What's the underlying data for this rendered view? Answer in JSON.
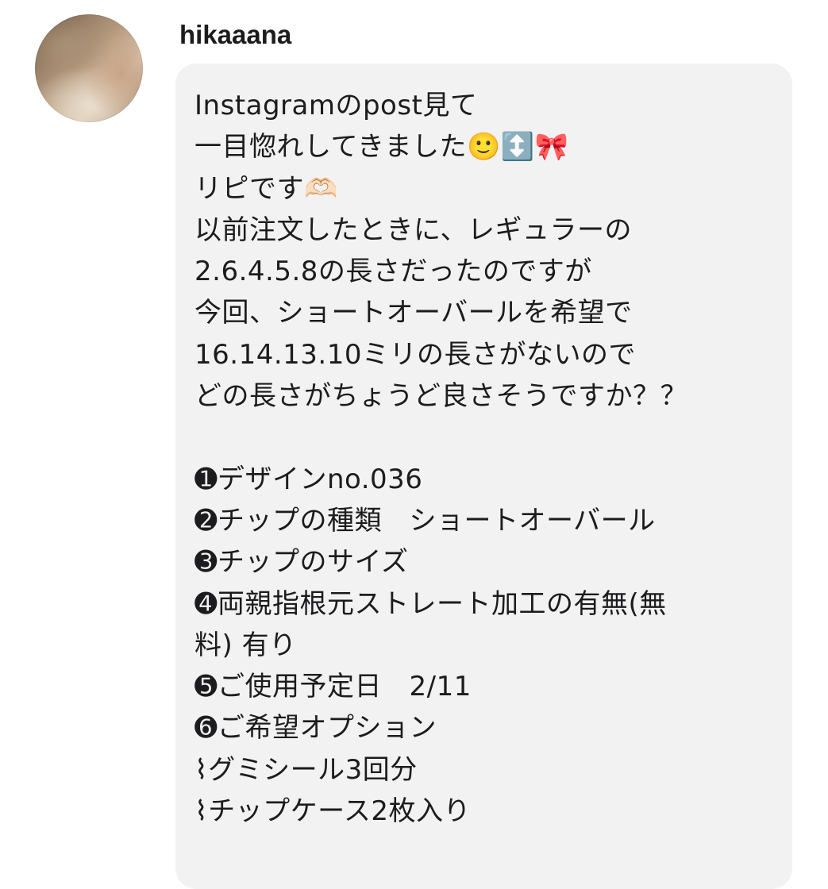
{
  "post": {
    "author": {
      "username": "hikaaana",
      "avatar_icon": "profile-photo"
    },
    "message": {
      "lines": [
        "Instagramのpost見て",
        "一目惚れしてきました🙂↕️🎀",
        "リピです🫶🏻",
        "以前注文したときに、レギュラーの",
        "2.6.4.5.8の長さだったのですが",
        "今回、ショートオーバールを希望で",
        "16.14.13.10ミリの長さがないので",
        "どの長さがちょうど良さそうですか？？",
        "",
        "➊デザインno.036",
        "➋チップの種類　ショートオーバール",
        "➌チップのサイズ",
        "➍両親指根元ストレート加工の有無(無",
        "料) 有り",
        "➎ご使用予定日　2/11",
        "➏ご希望オプション",
        "⌇グミシール3回分",
        "⌇チップケース2枚入り"
      ]
    }
  },
  "colors": {
    "bubble_background": "#f2f2f2",
    "text": "#1c1c1e",
    "page_background": "#ffffff"
  }
}
